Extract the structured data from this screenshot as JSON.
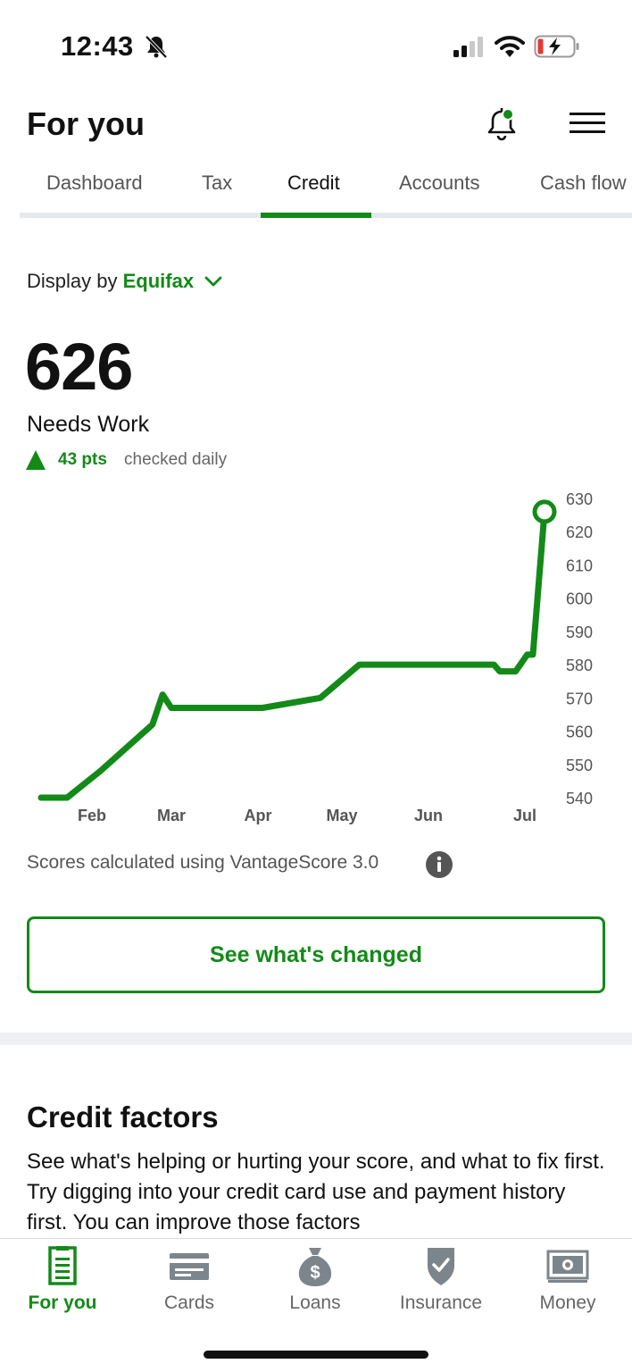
{
  "status_bar": {
    "time": "12:43"
  },
  "header": {
    "title": "For you"
  },
  "tabs": [
    {
      "label": "Dashboard"
    },
    {
      "label": "Tax"
    },
    {
      "label": "Credit"
    },
    {
      "label": "Accounts"
    },
    {
      "label": "Cash flow"
    }
  ],
  "active_tab": "Credit",
  "display_by": {
    "label": "Display by",
    "provider": "Equifax"
  },
  "score": {
    "value": "626",
    "rating": "Needs Work",
    "change": "43 pts",
    "frequency": "checked daily"
  },
  "chart_data": {
    "type": "line",
    "x_ticks": [
      "Feb",
      "Mar",
      "Apr",
      "May",
      "Jun",
      "Jul"
    ],
    "y_ticks": [
      540,
      550,
      560,
      570,
      580,
      590,
      600,
      610,
      620,
      630
    ],
    "ylim": [
      540,
      630
    ],
    "points": [
      {
        "x": "Jan 20",
        "y": 540
      },
      {
        "x": "Jan 29",
        "y": 540
      },
      {
        "x": "Feb 10",
        "y": 548
      },
      {
        "x": "Feb 28",
        "y": 562
      },
      {
        "x": "Mar 1",
        "y": 571
      },
      {
        "x": "Mar 4",
        "y": 567
      },
      {
        "x": "Apr 5",
        "y": 567
      },
      {
        "x": "Apr 25",
        "y": 570
      },
      {
        "x": "May 8",
        "y": 580
      },
      {
        "x": "Jun 24",
        "y": 580
      },
      {
        "x": "Jun 26",
        "y": 578
      },
      {
        "x": "Jul 1",
        "y": 578
      },
      {
        "x": "Jul 5",
        "y": 583
      },
      {
        "x": "Jul 7",
        "y": 583
      },
      {
        "x": "Jul 11",
        "y": 626
      }
    ],
    "line_color": "#138a18"
  },
  "footnote": "Scores calculated using VantageScore 3.0",
  "cta": {
    "label": "See what's changed"
  },
  "credit_factors": {
    "title": "Credit factors",
    "body": "See what's helping or hurting your score, and what to fix first. Try digging into your credit card use and payment history first. You can improve those factors"
  },
  "bottom_nav": [
    {
      "label": "For you",
      "icon": "document-icon"
    },
    {
      "label": "Cards",
      "icon": "credit-card-icon"
    },
    {
      "label": "Loans",
      "icon": "money-bag-icon"
    },
    {
      "label": "Insurance",
      "icon": "shield-check-icon"
    },
    {
      "label": "Money",
      "icon": "cash-icon"
    }
  ],
  "colors": {
    "accent": "#138a18",
    "muted": "#666666",
    "divider": "#eef0f2"
  }
}
